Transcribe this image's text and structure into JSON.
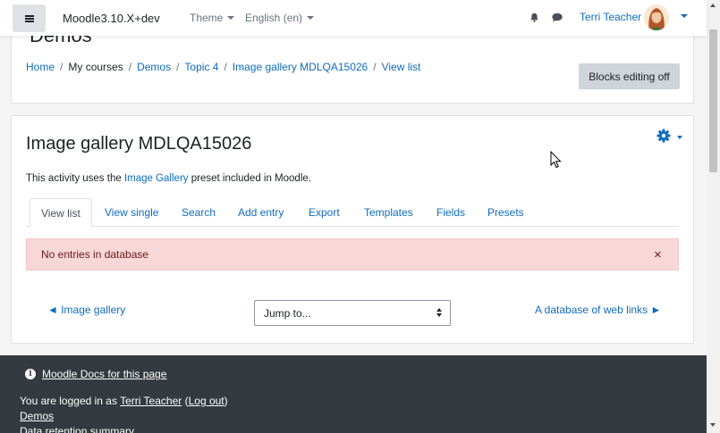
{
  "navbar": {
    "site_name": "Moodle3.10.X+dev",
    "theme_label": "Theme",
    "language_label": "English (en)",
    "user_name": "Terri Teacher"
  },
  "page_header": {
    "title": "Demos",
    "breadcrumb": [
      "Home",
      "My courses",
      "Demos",
      "Topic 4",
      "Image gallery MDLQA15026",
      "View list"
    ],
    "blocks_editing_button": "Blocks editing off"
  },
  "activity": {
    "title": "Image gallery MDLQA15026",
    "intro_prefix": "This activity uses the ",
    "intro_link": "Image Gallery",
    "intro_suffix": " preset included in Moodle.",
    "tabs": [
      "View list",
      "View single",
      "Search",
      "Add entry",
      "Export",
      "Templates",
      "Fields",
      "Presets"
    ],
    "active_tab": "View list",
    "alert_text": "No entries in database",
    "alert_close": "×",
    "prev_activity": "◄ Image gallery",
    "jump_select": "Jump to...",
    "next_activity": "A database of web links ►"
  },
  "footer": {
    "docs_link": "Moodle Docs for this page",
    "logged_in_prefix": "You are logged in as ",
    "logged_in_user": "Terri Teacher",
    "logout_open": " (",
    "logout_link": "Log out",
    "logout_close": ")",
    "course_link": "Demos",
    "retention_link": "Data retention summary"
  },
  "colors": {
    "link": "#0f6cbf",
    "alert_bg": "#f7d7d7",
    "footer_bg": "#343a40",
    "button_bg": "#ced4da"
  },
  "icons": {
    "menu": "hamburger-icon",
    "notifications": "bell-icon",
    "messages": "chat-icon",
    "activity_menu": "gear-icon",
    "info": "info-icon"
  }
}
